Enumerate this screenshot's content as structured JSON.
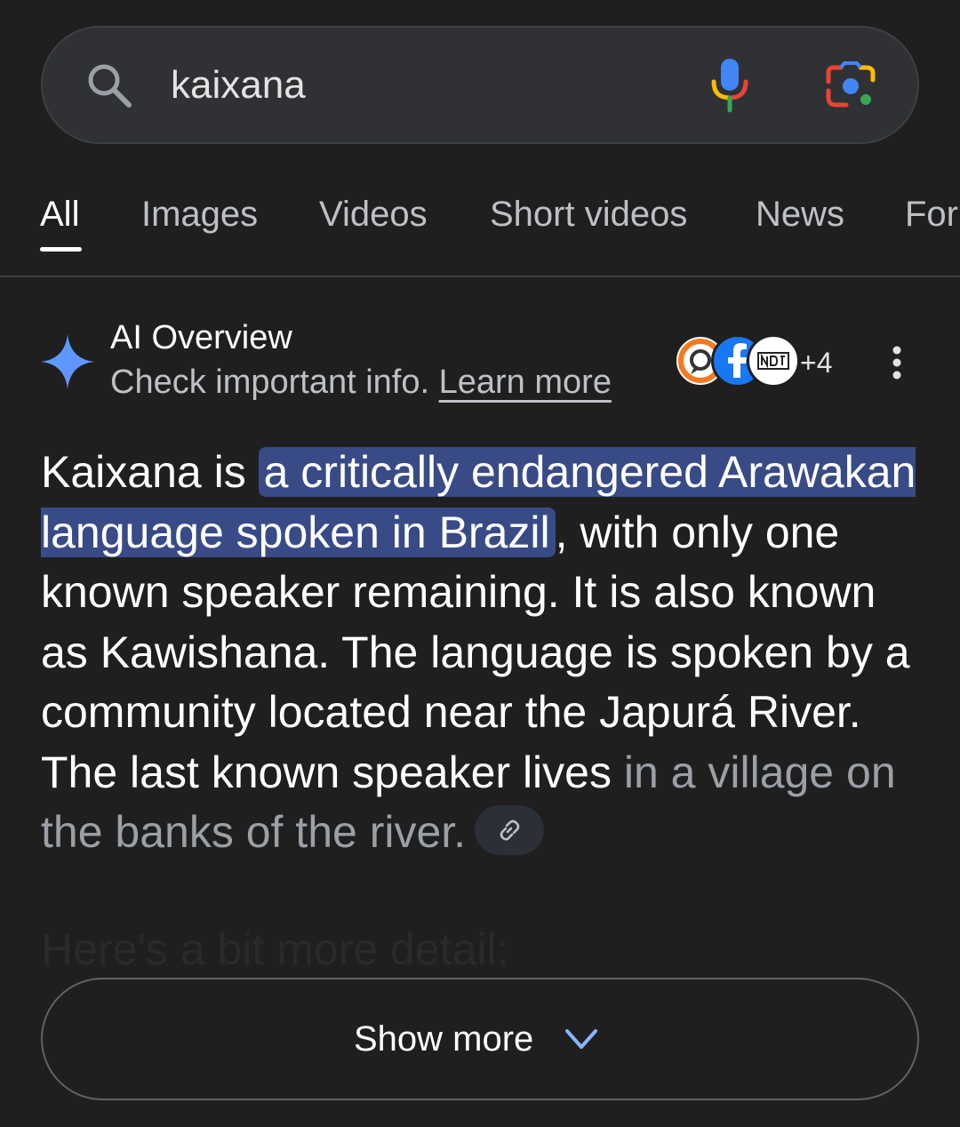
{
  "search": {
    "query": "kaixana",
    "icons": {
      "search": "search-icon",
      "mic": "mic-icon",
      "lens": "lens-icon"
    }
  },
  "tabs": [
    {
      "label": "All",
      "active": true
    },
    {
      "label": "Images"
    },
    {
      "label": "Videos"
    },
    {
      "label": "Short videos"
    },
    {
      "label": "News"
    },
    {
      "label": "For"
    }
  ],
  "ai_overview": {
    "title": "AI Overview",
    "subtitle": "Check important info.",
    "learn_more": "Learn more",
    "sources_extra": "+4",
    "body": {
      "p1": "Kaixana is ",
      "highlight": "a critically endangered Arawakan language spoken in Brazil",
      "p2": ", with only one known speaker remaining. It is also known as Kawishana. The language is spoken by a community located near the Japurá River. The last known speaker lives ",
      "p3": "in a village on the banks of the river."
    },
    "more_detail": "Here's a bit more detail:"
  },
  "show_more": {
    "label": "Show more"
  },
  "colors": {
    "background": "#1f1f1f",
    "highlight": "#394b86",
    "accent_blue": "#8ab4f8"
  }
}
